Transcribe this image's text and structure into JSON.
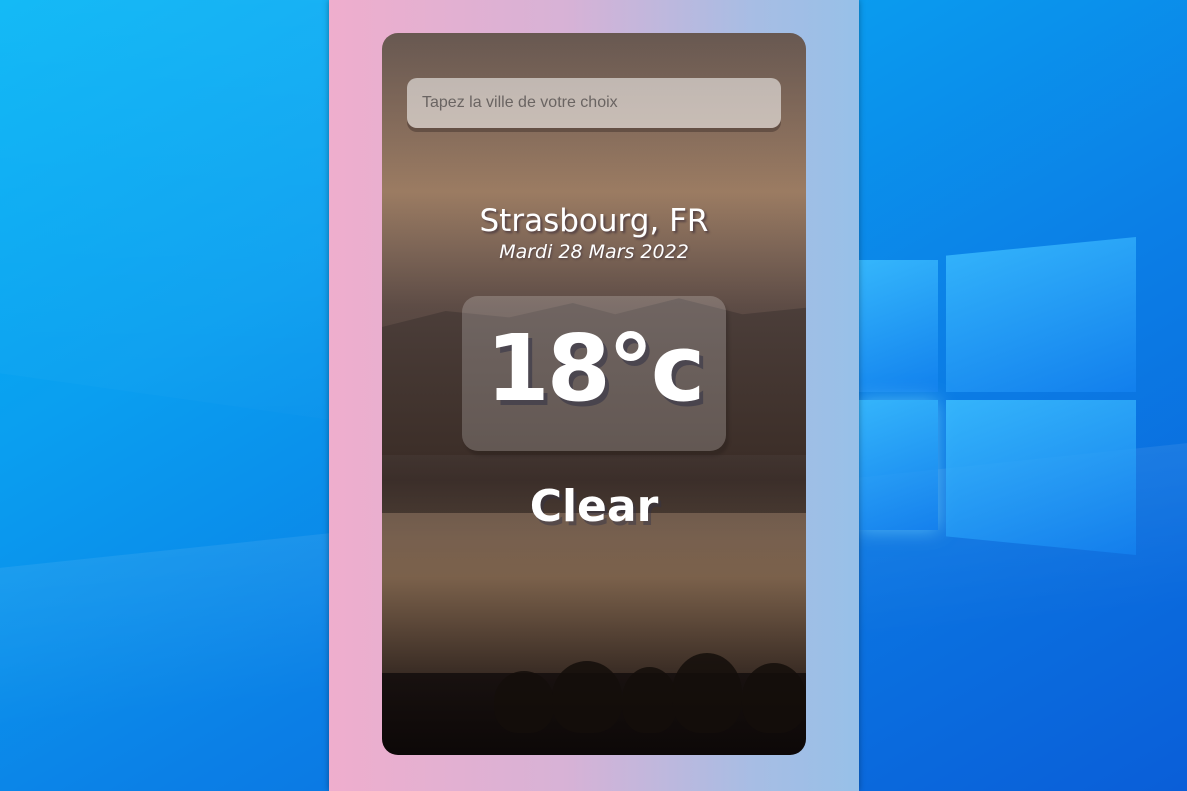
{
  "search": {
    "placeholder": "Tapez la ville de votre choix"
  },
  "location": "Strasbourg, FR",
  "date": "Mardi 28 Mars 2022",
  "temperature": "18°c",
  "condition": "Clear"
}
